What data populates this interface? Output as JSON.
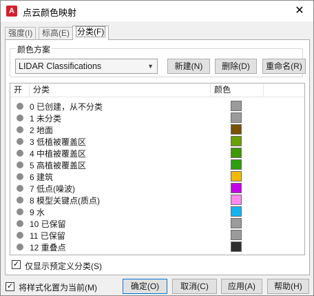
{
  "window": {
    "title": "点云颜色映射",
    "app_icon_letter": "A",
    "close_glyph": "✕"
  },
  "tabs": [
    {
      "label": "强度(I)",
      "active": false
    },
    {
      "label": "标高(E)",
      "active": false
    },
    {
      "label": "分类(F)",
      "active": true
    }
  ],
  "color_scheme": {
    "group_label": "颜色方案",
    "selected": "LIDAR Classifications",
    "new_button": "新建(N)",
    "delete_button": "删除(D)",
    "rename_button": "重命名(R)"
  },
  "table": {
    "headers": {
      "on": "开",
      "category": "分类",
      "color": "颜色"
    },
    "rows": [
      {
        "label": "0 已创建，从不分类",
        "color": "#9b9b9b"
      },
      {
        "label": "1 未分类",
        "color": "#9b9b9b"
      },
      {
        "label": "2 地面",
        "color": "#7a5200"
      },
      {
        "label": "3 低植被覆盖区",
        "color": "#6aa000"
      },
      {
        "label": "4 中植被覆盖区",
        "color": "#3c9a00"
      },
      {
        "label": "5 高植被覆盖区",
        "color": "#2c9f0c"
      },
      {
        "label": "6 建筑",
        "color": "#f5b800"
      },
      {
        "label": "7 低点(噪波)",
        "color": "#c300e6"
      },
      {
        "label": "8 模型关键点(质点)",
        "color": "#ff88ee"
      },
      {
        "label": "9 水",
        "color": "#13b4f0"
      },
      {
        "label": "10 已保留",
        "color": "#9b9b9b"
      },
      {
        "label": "11 已保留",
        "color": "#9b9b9b"
      },
      {
        "label": "12 重叠点",
        "color": "#2e2e2e"
      }
    ]
  },
  "show_predefined": {
    "label": "仅显示预定义分类(S)",
    "checked": true
  },
  "footer": {
    "set_current_label": "将样式化置为当前(M)",
    "set_current_checked": true,
    "ok": "确定(O)",
    "cancel": "取消(C)",
    "apply": "应用(A)",
    "help": "帮助(H)"
  },
  "check_glyph": "✓"
}
